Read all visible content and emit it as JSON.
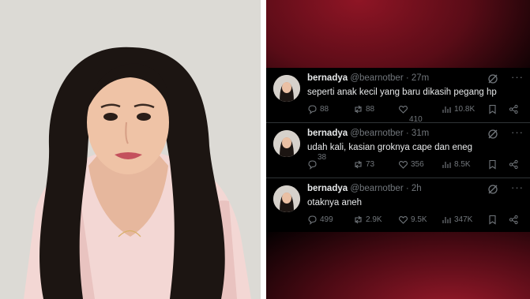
{
  "tweets": [
    {
      "name": "bernadya",
      "handle": "@bearnotber",
      "time": "· 27m",
      "text": "seperti anak kecil yang baru dikasih pegang hp",
      "replies": "88",
      "reposts": "88",
      "likes": "410",
      "views": "10.8K"
    },
    {
      "name": "bernadya",
      "handle": "@bearnotber",
      "time": "· 31m",
      "text": "udah kali, kasian groknya cape dan eneg",
      "replies": "38",
      "reposts": "73",
      "likes": "356",
      "views": "8.5K"
    },
    {
      "name": "bernadya",
      "handle": "@bearnotber",
      "time": "· 2h",
      "text": "otaknya aneh",
      "replies": "499",
      "reposts": "2.9K",
      "likes": "9.5K",
      "views": "347K"
    }
  ],
  "more_menu": "···",
  "icons": [
    "grok-icon",
    "reply-icon",
    "repost-icon",
    "like-icon",
    "views-icon",
    "bookmark-icon",
    "share-icon",
    "more-icon"
  ],
  "colors": {
    "panel_bg": "#000000",
    "accent_red": "#8f1525",
    "text": "#e7e9ea",
    "muted": "#71767b"
  }
}
